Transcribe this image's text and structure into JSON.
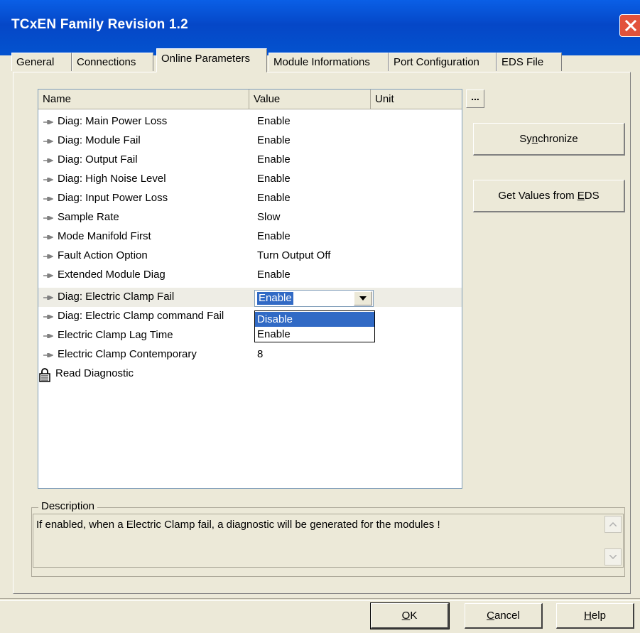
{
  "window": {
    "title": "TCxEN Family Revision 1.2"
  },
  "tabs": [
    {
      "label": "General"
    },
    {
      "label": "Connections"
    },
    {
      "label": "Online Parameters"
    },
    {
      "label": "Module Informations"
    },
    {
      "label": "Port Configuration"
    },
    {
      "label": "EDS File"
    }
  ],
  "active_tab": "Online Parameters",
  "grid": {
    "columns": {
      "name": "Name",
      "value": "Value",
      "unit": "Unit"
    },
    "ellipsis_label": "...",
    "rows": [
      {
        "name": "Diag: Main Power Loss",
        "value": "Enable"
      },
      {
        "name": "Diag: Module Fail",
        "value": "Enable"
      },
      {
        "name": "Diag: Output Fail",
        "value": "Enable"
      },
      {
        "name": "Diag: High Noise Level",
        "value": "Enable"
      },
      {
        "name": "Diag: Input Power Loss",
        "value": "Enable"
      },
      {
        "name": "Sample Rate",
        "value": "Slow"
      },
      {
        "name": "Mode Manifold First",
        "value": "Enable"
      },
      {
        "name": "Fault Action Option",
        "value": "Turn Output Off"
      },
      {
        "name": "Extended Module Diag",
        "value": "Enable"
      },
      {
        "name": "Diag: Electric Clamp Fail",
        "value": "Enable"
      },
      {
        "name": "Diag: Electric Clamp command Fail",
        "value": ""
      },
      {
        "name": "Electric Clamp Lag Time",
        "value": ""
      },
      {
        "name": "Electric Clamp Contemporary",
        "value": "8"
      }
    ],
    "group": {
      "name": "Read Diagnostic"
    },
    "editor": {
      "selected_value": "Enable",
      "options": [
        "Disable",
        "Enable"
      ],
      "highlighted_option": "Disable"
    }
  },
  "side_buttons": {
    "synchronize": {
      "pre": "Sy",
      "accel": "n",
      "post": "chronize"
    },
    "get_values": {
      "pre": "Get Values from ",
      "accel": "E",
      "post": "DS"
    }
  },
  "description": {
    "legend": "Description",
    "text": "If enabled, when a Electric Clamp fail, a diagnostic will be generated for the modules !"
  },
  "dialog_buttons": {
    "ok": {
      "accel": "O",
      "post": "K"
    },
    "cancel": {
      "accel": "C",
      "post": "ancel"
    },
    "help": {
      "accel": "H",
      "post": "elp"
    }
  },
  "colors": {
    "titlebar": "#0547c7",
    "selection": "#316ac5",
    "dialog_bg": "#ece9d8",
    "close": "#e2523b"
  }
}
